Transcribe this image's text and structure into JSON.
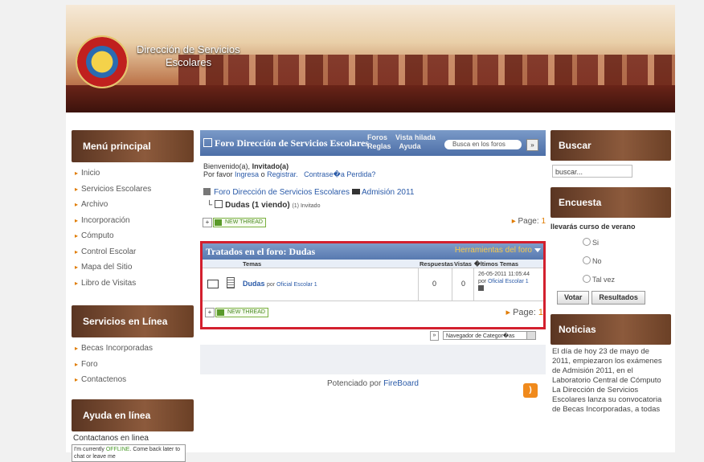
{
  "site": {
    "title_line1": "Dirección de Servicios",
    "title_line2": "Escolares"
  },
  "left": {
    "menu_title": "Menú principal",
    "menu_items": [
      "Inicio",
      "Servicios Escolares",
      "Archivo",
      "Incorporación",
      "Cómputo",
      "Control Escolar",
      "Mapa del Sitio",
      "Libro de Visitas"
    ],
    "online_title": "Servicios en Línea",
    "online_items": [
      "Becas Incorporadas",
      "Foro",
      "Contactenos"
    ],
    "help_title": "Ayuda en línea",
    "help_text": "Contactanos en linea",
    "offline_pre": "I'm currently",
    "offline_status": "OFFLINE",
    "offline_post": "Come back later to chat or leave me"
  },
  "forum": {
    "title": "Foro Dirección de Servicios Escolares",
    "link_foros": "Foros",
    "link_vista": "Vista hilada",
    "link_reglas": "Reglas",
    "link_ayuda": "Ayuda",
    "search_placeholder": "Busca en los foros",
    "welcome_pre": "Bienvenido(a),",
    "welcome_user": "Invitado(a)",
    "welcome_line2_pre": "Por favor",
    "login": "Ingresa",
    "or": "o",
    "register": "Registrar.",
    "lost_pw": "Contrase�a Perdida?",
    "crumb_forum": "Foro Dirección de Servicios Escolares",
    "crumb_category": "Admisión 2011",
    "crumb_sub": "Dudas (1 viendo)",
    "crumb_sub_viewer": "(1) Invitado",
    "new_thread": "NEW THREAD",
    "page_label": "Page:",
    "page_num": "1",
    "topics_title": "Tratados en el foro: Dudas",
    "tools": "Herramientas del foro",
    "col_topics": "Temas",
    "col_replies": "Respuestas",
    "col_views": "Vistas",
    "col_last": "�ltimos Temas",
    "topic": {
      "name": "Dudas",
      "by": "por",
      "author": "Oficial Escolar 1",
      "replies": "0",
      "views": "0",
      "last_date": "26-05-2011 11:05:44",
      "last_by": "por",
      "last_author": "Oficial Escolar 1"
    },
    "category_nav": "Navegador de Categor�as",
    "powered_pre": "Potenciado por",
    "powered_link": "FireBoard"
  },
  "right": {
    "search_title": "Buscar",
    "search_value": "buscar...",
    "poll_title": "Encuesta",
    "poll_question": "llevarás curso de verano",
    "poll_options": [
      "Si",
      "No",
      "Tal vez"
    ],
    "vote": "Votar",
    "results": "Resultados",
    "news_title": "Noticias",
    "news_text": "El día de hoy 23 de mayo de 2011, empiezaron los exámenes de Admisión 2011, en el Laboratorio Central de Cómputo La Dirección de Servicios Escolares lanza su convocatoria de Becas Incorporadas, a todas"
  }
}
